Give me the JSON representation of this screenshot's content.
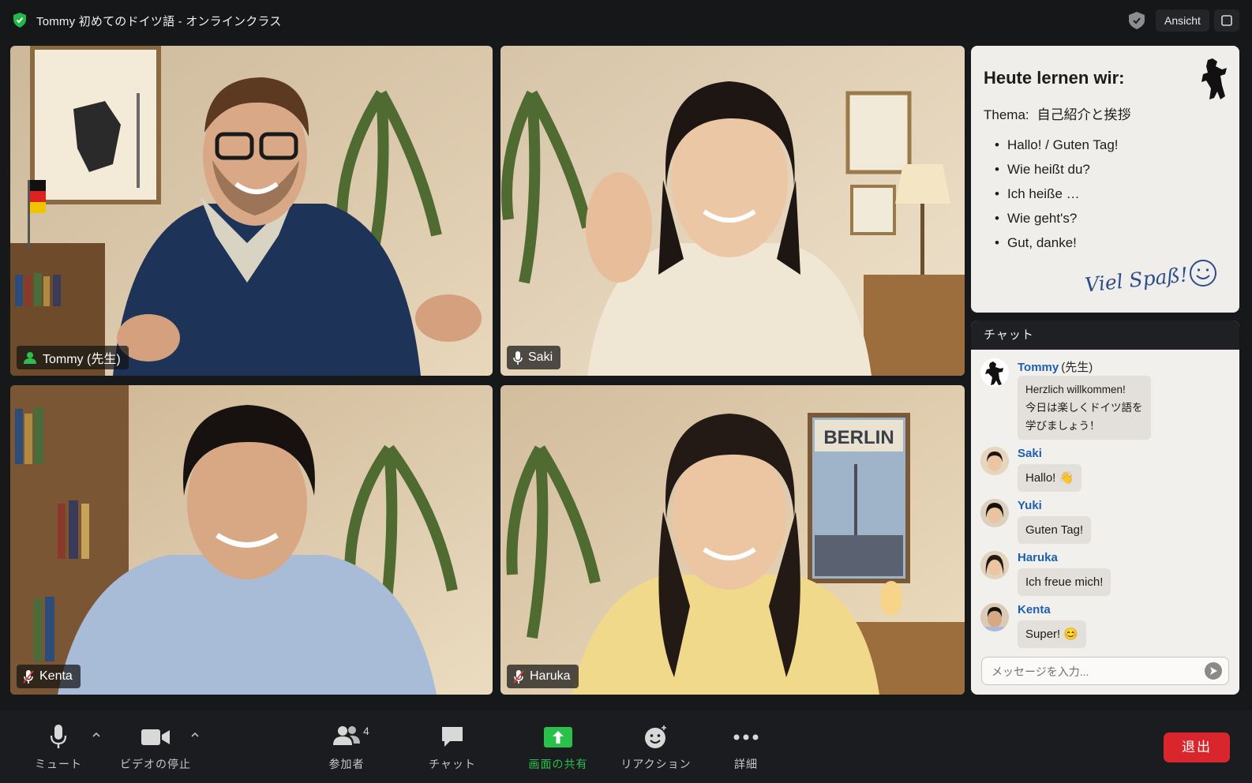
{
  "window": {
    "title": "Tommy 初めてのドイツ語 - オンラインクラス",
    "view_button": "Ansicht"
  },
  "participants": [
    {
      "name": "Tommy (先生)",
      "audio": "host"
    },
    {
      "name": "Saki",
      "audio": "mic-on"
    },
    {
      "name": "Kenta",
      "audio": "mic-muted"
    },
    {
      "name": "Haruka",
      "audio": "mic-muted"
    }
  ],
  "lesson": {
    "heading": "Heute lernen wir:",
    "thema_label": "Thema:",
    "thema_value": "自己紹介と挨拶",
    "items": [
      "Hallo! / Guten Tag!",
      "Wie heißt du?",
      "Ich heiße …",
      "Wie geht's?",
      "Gut, danke!"
    ],
    "sign_off": "Viel Spaß!",
    "poster_text": "BERLIN"
  },
  "chat": {
    "header": "チャット",
    "messages": [
      {
        "sender": "Tommy",
        "role": "(先生)",
        "text": "Herzlich willkommen!\n今日は楽しくドイツ語を\n学びましょう！",
        "avatar": "berlin-bear-icon"
      },
      {
        "sender": "Saki",
        "role": "",
        "text": "Hallo! 👋",
        "avatar": "saki-avatar"
      },
      {
        "sender": "Yuki",
        "role": "",
        "text": "Guten Tag!",
        "avatar": "yuki-avatar"
      },
      {
        "sender": "Haruka",
        "role": "",
        "text": "Ich freue mich!",
        "avatar": "haruka-avatar"
      },
      {
        "sender": "Kenta",
        "role": "",
        "text": "Super! 😊",
        "avatar": "kenta-avatar"
      }
    ],
    "input_placeholder": "メッセージを入力..."
  },
  "toolbar": {
    "mute": "ミュート",
    "stop_video": "ビデオの停止",
    "participants": "参加者",
    "participant_count": "4",
    "chat": "チャット",
    "share_screen": "画面の共有",
    "reactions": "リアクション",
    "more": "詳細",
    "leave": "退出"
  },
  "colors": {
    "accent_green": "#28c24a",
    "leave_red": "#d8262c",
    "chat_name_blue": "#1e5fb0"
  }
}
